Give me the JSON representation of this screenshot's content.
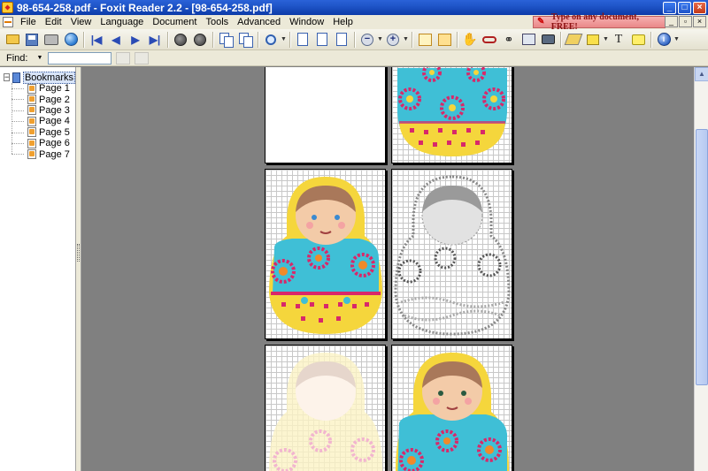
{
  "window": {
    "title": "98-654-258.pdf - Foxit Reader 2.2 - [98-654-258.pdf]",
    "controls": [
      "_",
      "□",
      "×"
    ]
  },
  "menu": {
    "items": [
      "File",
      "Edit",
      "View",
      "Language",
      "Document",
      "Tools",
      "Advanced",
      "Window",
      "Help"
    ],
    "ad_text": "Type on any document, FREE!",
    "mdi_controls": [
      "_",
      "▫",
      "×"
    ]
  },
  "findbar": {
    "label": "Find:",
    "value": ""
  },
  "sidebar": {
    "root_label": "Bookmarks",
    "pages": [
      "Page 1",
      "Page 2",
      "Page 3",
      "Page 4",
      "Page 5",
      "Page 6",
      "Page 7"
    ]
  },
  "colors": {
    "yellow": "#f5d63c",
    "cyan": "#3fbfd6",
    "magenta": "#d8286a",
    "orange": "#f08a2a",
    "skin": "#f3cba8",
    "hair": "#a9785a"
  }
}
